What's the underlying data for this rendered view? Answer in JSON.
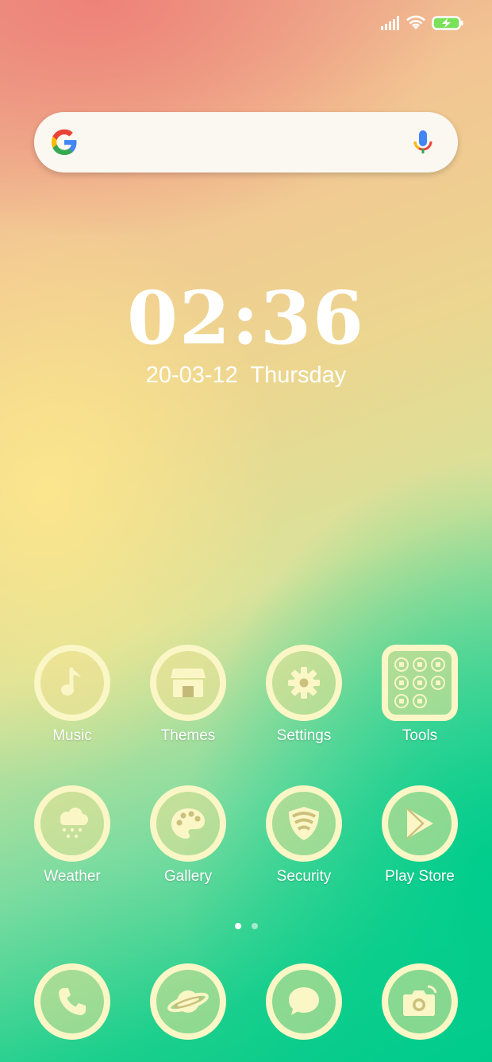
{
  "status_bar": {
    "signal_icon": "signal-bars-icon",
    "wifi_icon": "wifi-icon",
    "battery_icon": "battery-charging-icon",
    "battery_color": "#7be05a"
  },
  "search": {
    "logo_icon": "google-g-icon",
    "mic_icon": "microphone-icon",
    "placeholder": ""
  },
  "clock": {
    "time": "02:36",
    "date": "20-03-12  Thursday"
  },
  "apps": [
    {
      "label": "Music",
      "icon": "music-note-icon"
    },
    {
      "label": "Themes",
      "icon": "store-icon"
    },
    {
      "label": "Settings",
      "icon": "gear-icon"
    },
    {
      "label": "Tools",
      "icon": "folder-icon"
    },
    {
      "label": "Weather",
      "icon": "cloud-snow-icon"
    },
    {
      "label": "Gallery",
      "icon": "palette-icon"
    },
    {
      "label": "Security",
      "icon": "shield-icon"
    },
    {
      "label": "Play Store",
      "icon": "play-store-icon"
    }
  ],
  "page_dots": {
    "count": 2,
    "active": 1
  },
  "dock": [
    {
      "icon": "phone-icon"
    },
    {
      "icon": "browser-planet-icon"
    },
    {
      "icon": "message-icon"
    },
    {
      "icon": "camera-icon"
    }
  ],
  "colors": {
    "icon_ring": "#fbf6c6",
    "text": "#ffffff",
    "search_bg": "#fbf8f2"
  }
}
